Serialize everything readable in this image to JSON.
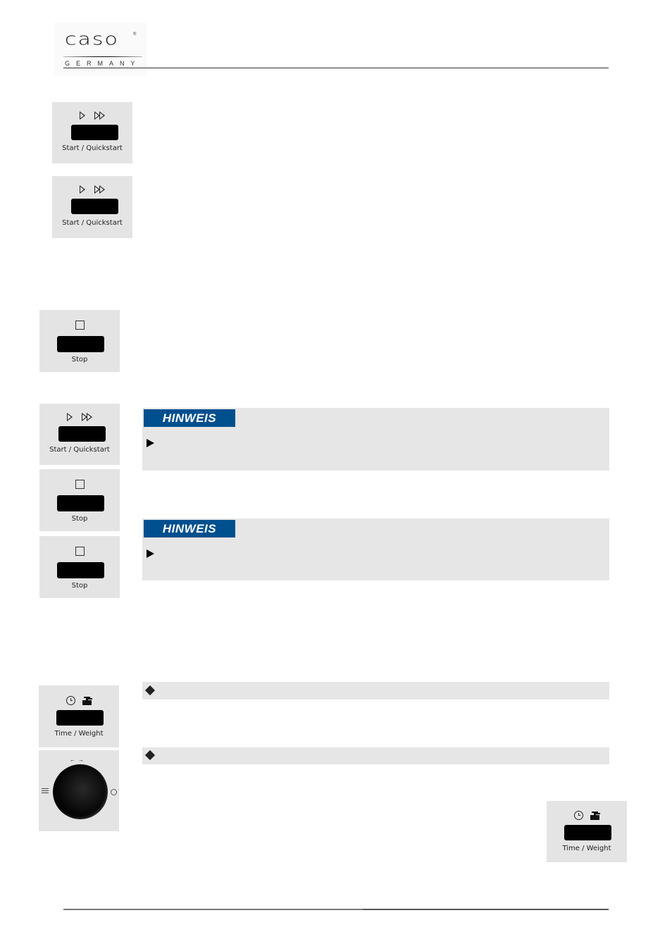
{
  "header": {
    "brand": "caso",
    "brand_sub": "GERMANY",
    "registered_mark": "®"
  },
  "panels": {
    "start_quickstart_1": {
      "label": "Start / Quickstart",
      "icons": [
        "play-icon",
        "fast-forward-icon"
      ]
    },
    "start_quickstart_2": {
      "label": "Start / Quickstart",
      "icons": [
        "play-icon",
        "fast-forward-icon"
      ]
    },
    "stop_1": {
      "label": "Stop",
      "icons": [
        "stop-square-icon"
      ]
    },
    "start_quickstart_3": {
      "label": "Start / Quickstart",
      "icons": [
        "play-icon",
        "fast-forward-icon"
      ]
    },
    "stop_2": {
      "label": "Stop",
      "icons": [
        "stop-square-icon"
      ]
    },
    "stop_3": {
      "label": "Stop",
      "icons": [
        "stop-square-icon"
      ]
    },
    "time_weight_1": {
      "label": "Time / Weight",
      "icons": [
        "clock-icon",
        "weight-icon"
      ]
    },
    "rotary_knob": {
      "icons": [
        "rotate-arrows-icon",
        "menu-list-icon",
        "clock-icon"
      ]
    },
    "time_weight_2": {
      "label": "Time / Weight",
      "icons": [
        "clock-icon",
        "weight-icon"
      ]
    }
  },
  "notices": [
    {
      "badge": "HINWEIS",
      "bullet": "arrow-right-icon"
    },
    {
      "badge": "HINWEIS",
      "bullet": "arrow-right-icon"
    }
  ],
  "strips": [
    {
      "bullet": "diamond-icon"
    },
    {
      "bullet": "diamond-icon"
    }
  ]
}
